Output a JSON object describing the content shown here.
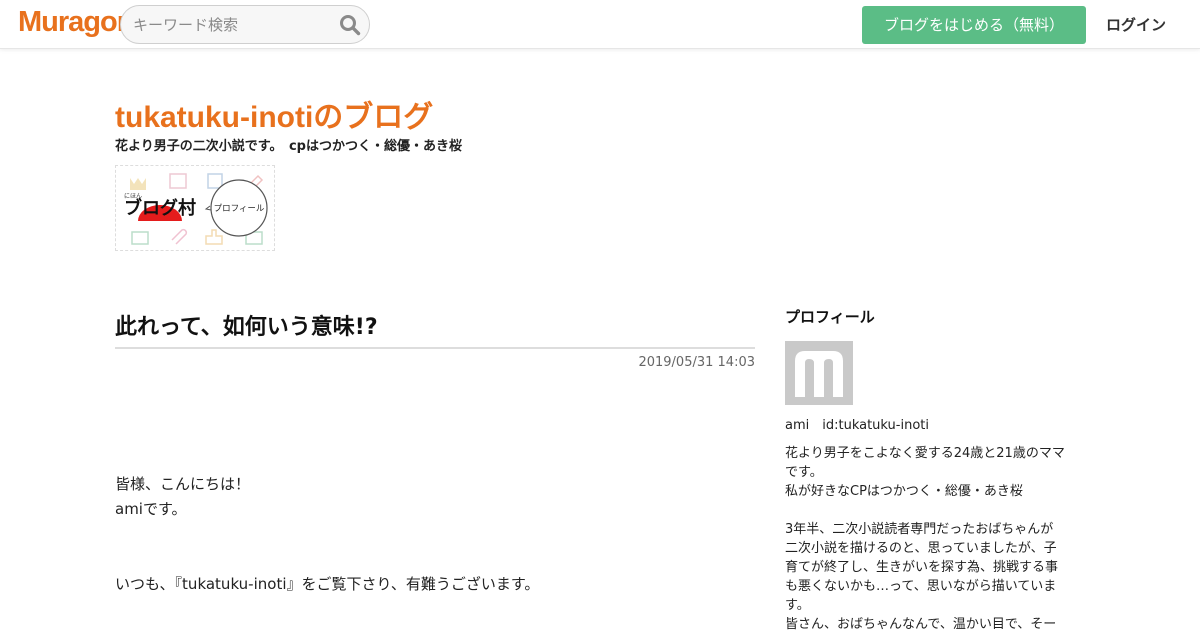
{
  "header": {
    "logo": "Muragon",
    "search_placeholder": "キーワード検索",
    "cta_label": "ブログをはじめる（無料）",
    "login_label": "ログイン"
  },
  "blog": {
    "title": "tukatuku-inotiのブログ",
    "description": "花より男子の二次小説です。　cpはつかつく・総優・あき桜",
    "banner": {
      "small_label": "にほん",
      "main_label": "ブログ村",
      "bubble_label": "プロフィール"
    }
  },
  "article": {
    "title": "此れって、如何いう意味!?",
    "date": "2019/05/31 14:03",
    "lines": [
      "皆様、こんにちは！",
      "amiです。",
      "いつも、『tukatuku-inoti』をご覧下さり、有難うございます。"
    ]
  },
  "sidebar": {
    "heading": "プロフィール",
    "user": "ami　id:tukatuku-inoti",
    "bio": [
      "花より男子をこよなく愛する24歳と21歳のママ",
      "です。",
      "私が好きなCPはつかつく・総優・あき桜",
      "",
      "3年半、二次小説読者専門だったおばちゃんが",
      "二次小説を描けるのと、思っていましたが、子",
      "育てが終了し、生きがいを探す為、挑戦する事",
      "も悪くないかも…って、思いながら描いていま",
      "す。",
      "皆さん、おばちゃんなんで、温かい目で、そー"
    ]
  },
  "colors": {
    "brand_orange": "#e8711d",
    "cta_green": "#5bbd86"
  }
}
